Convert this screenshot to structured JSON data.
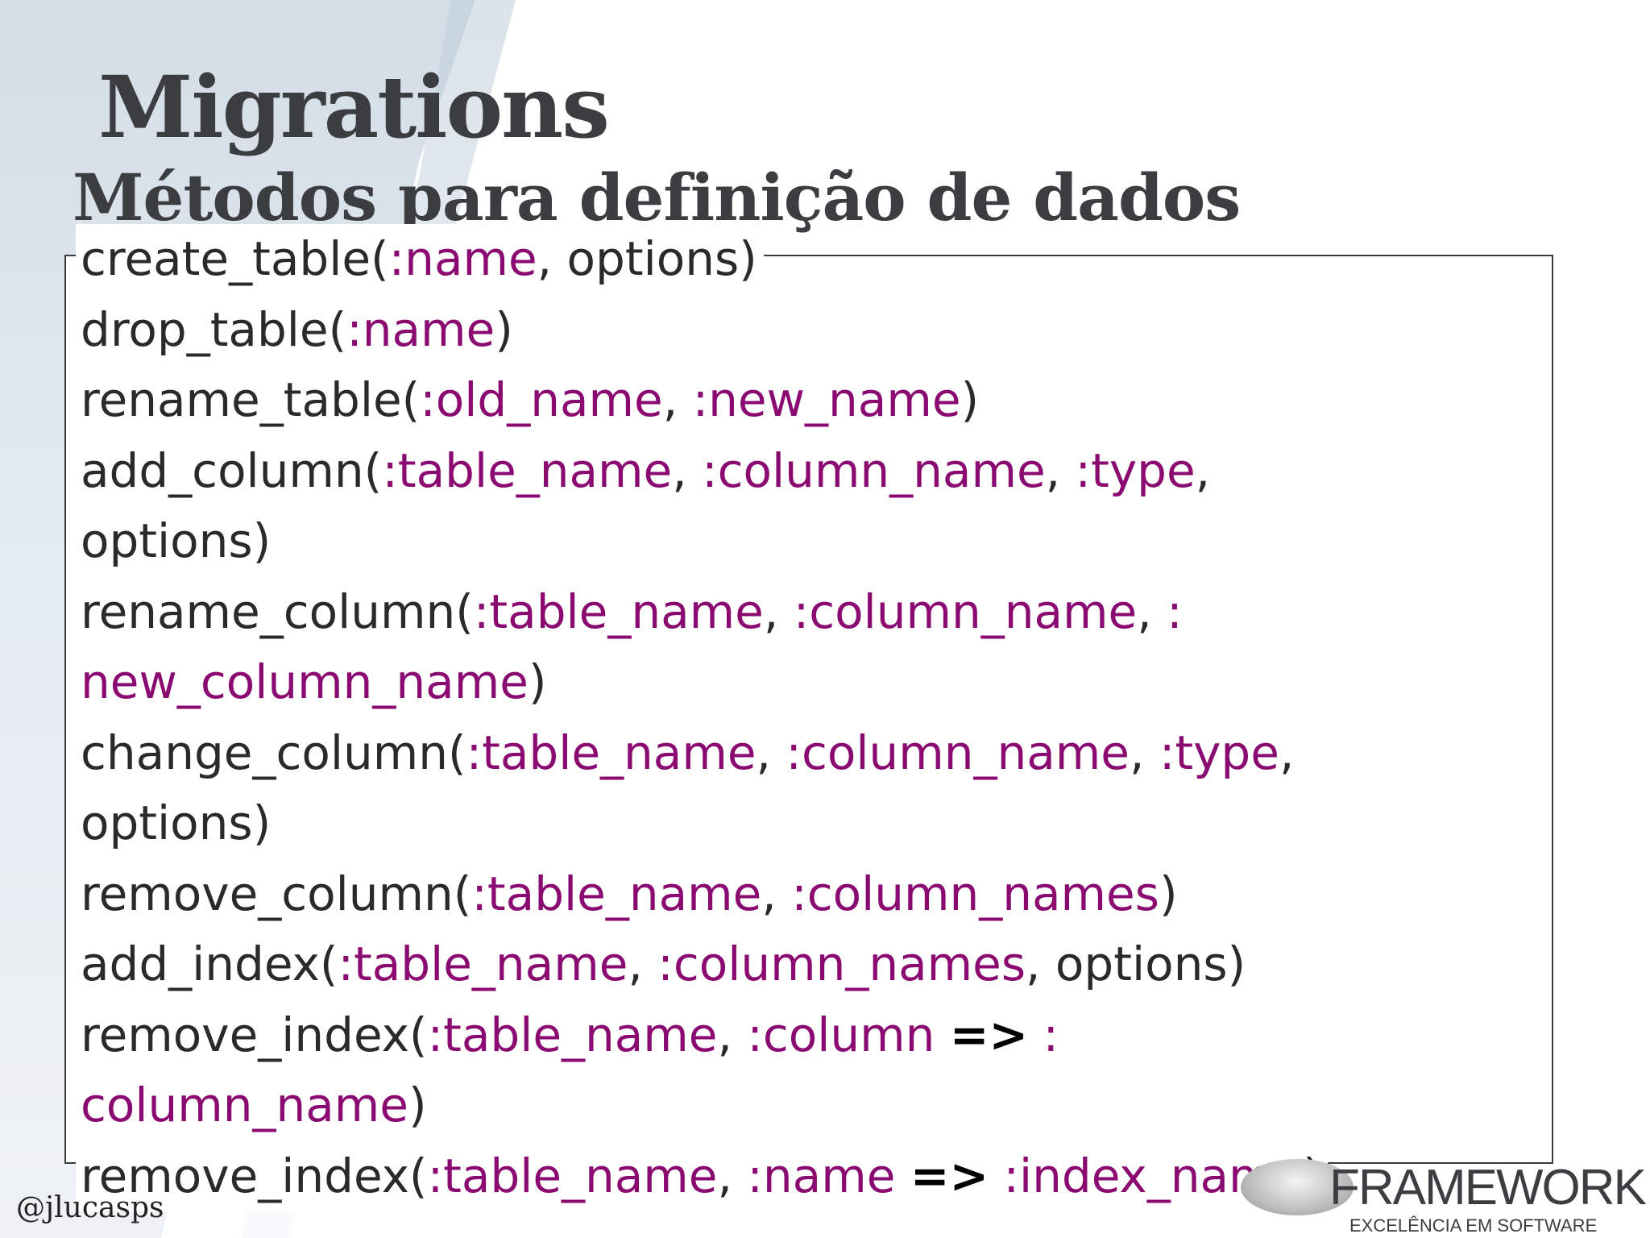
{
  "slide": {
    "title": "Migrations",
    "subtitle": "Métodos para definição de dados",
    "handle": "@jlucasps"
  },
  "code_lines": [
    [
      {
        "t": "create_table("
      },
      {
        "t": ":name",
        "k": "sym"
      },
      {
        "t": ", options)"
      }
    ],
    [
      {
        "t": "drop_table("
      },
      {
        "t": ":name",
        "k": "sym"
      },
      {
        "t": ")"
      }
    ],
    [
      {
        "t": "rename_table("
      },
      {
        "t": ":old_name",
        "k": "sym"
      },
      {
        "t": ", "
      },
      {
        "t": ":new_name",
        "k": "sym"
      },
      {
        "t": ")"
      }
    ],
    [
      {
        "t": "add_column("
      },
      {
        "t": ":table_name",
        "k": "sym"
      },
      {
        "t": ", "
      },
      {
        "t": ":column_name",
        "k": "sym"
      },
      {
        "t": ", "
      },
      {
        "t": ":type",
        "k": "sym"
      },
      {
        "t": ","
      }
    ],
    [
      {
        "t": "options)"
      }
    ],
    [
      {
        "t": "rename_column("
      },
      {
        "t": ":table_name",
        "k": "sym"
      },
      {
        "t": ", "
      },
      {
        "t": ":column_name",
        "k": "sym"
      },
      {
        "t": ", "
      },
      {
        "t": ":",
        "k": "sym"
      }
    ],
    [
      {
        "t": "new_column_name",
        "k": "sym"
      },
      {
        "t": ")"
      }
    ],
    [
      {
        "t": "change_column("
      },
      {
        "t": ":table_name",
        "k": "sym"
      },
      {
        "t": ", "
      },
      {
        "t": ":column_name",
        "k": "sym"
      },
      {
        "t": ", "
      },
      {
        "t": ":type",
        "k": "sym"
      },
      {
        "t": ","
      }
    ],
    [
      {
        "t": "options)"
      }
    ],
    [
      {
        "t": "remove_column("
      },
      {
        "t": ":table_name",
        "k": "sym"
      },
      {
        "t": ", "
      },
      {
        "t": ":column_names",
        "k": "sym"
      },
      {
        "t": ")"
      }
    ],
    [
      {
        "t": "add_index("
      },
      {
        "t": ":table_name",
        "k": "sym"
      },
      {
        "t": ", "
      },
      {
        "t": ":column_names",
        "k": "sym"
      },
      {
        "t": ", options)"
      }
    ],
    [
      {
        "t": "remove_index("
      },
      {
        "t": ":table_name",
        "k": "sym"
      },
      {
        "t": ", "
      },
      {
        "t": ":column",
        "k": "sym"
      },
      {
        "t": " "
      },
      {
        "t": "=>",
        "k": "arrow"
      },
      {
        "t": " "
      },
      {
        "t": ":",
        "k": "sym"
      }
    ],
    [
      {
        "t": "column_name",
        "k": "sym"
      },
      {
        "t": ")"
      }
    ],
    [
      {
        "t": "remove_index("
      },
      {
        "t": ":table_name",
        "k": "sym"
      },
      {
        "t": ", "
      },
      {
        "t": ":name",
        "k": "sym"
      },
      {
        "t": " "
      },
      {
        "t": "=>",
        "k": "arrow"
      },
      {
        "t": " "
      },
      {
        "t": ":index_name",
        "k": "sym"
      },
      {
        "t": ")"
      }
    ]
  ],
  "logo": {
    "word": "FRAMEWORK",
    "tagline": "EXCELÊNCIA EM SOFTWARE"
  },
  "colors": {
    "text": "#3b3d40",
    "code_text": "#2a2a2a",
    "symbol": "#8b0a72",
    "arrow": "#000000"
  }
}
